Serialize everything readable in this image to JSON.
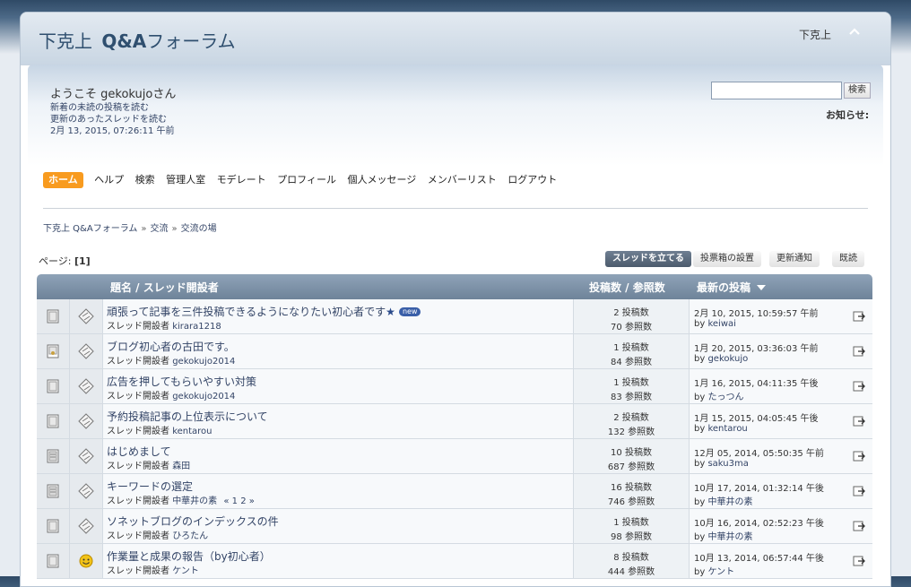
{
  "header": {
    "forum_title_prefix": "下克上",
    "forum_title_bold": "Q&A",
    "forum_title_suffix": "フォーラム",
    "top_right_text": "下克上",
    "upshrink_icon": "chevron-up-icon"
  },
  "user": {
    "welcome": "ようこそ gekokujoさん",
    "link_unread": "新着の未読の投稿を読む",
    "link_replies": "更新のあったスレッドを読む",
    "datetime": "2月 13, 2015, 07:26:11 午前"
  },
  "search": {
    "value": "",
    "button": "検索"
  },
  "news_label": "お知らせ:",
  "menu": {
    "items": [
      "ホーム",
      "ヘルプ",
      "検索",
      "管理人室",
      "モデレート",
      "プロフィール",
      "個人メッセージ",
      "メンバーリスト",
      "ログアウト"
    ],
    "active": "ホーム"
  },
  "breadcrumb": [
    "下克上 Q&Aフォーラム",
    "交流",
    "交流の場"
  ],
  "breadcrumb_sep": "»",
  "pages": {
    "label": "ページ:",
    "current": "[1]"
  },
  "buttons": {
    "new_topic": "スレッドを立てる",
    "new_poll": "投票箱の設置",
    "notify": "更新通知",
    "mark_read": "既読"
  },
  "table": {
    "col_subject": "題名 / スレッド開設者",
    "col_stats": "投稿数 / 参照数",
    "col_last": "最新の投稿",
    "sort_icon": "sort-down-icon",
    "started_by_label": "スレッド開設者",
    "posts_suffix": "投稿数",
    "views_suffix": "参照数",
    "by_label": "by",
    "rows": [
      {
        "title": "頑張って記事を三件投稿できるようになりたい初心者です",
        "title_star": "★",
        "new_badge": "new",
        "starter": "kirara1218",
        "posts": "2",
        "views": "70",
        "last_date": "2月 10, 2015, 10:59:57 午前",
        "last_by": "keiwai",
        "icon": "normal-topic-icon",
        "post_icon": "xx-icon"
      },
      {
        "title": "ブログ初心者の古田です。",
        "title_star": "",
        "new_badge": "",
        "starter": "gekokujo2014",
        "posts": "1",
        "views": "84",
        "last_date": "1月 20, 2015, 03:36:03 午前",
        "last_by": "gekokujo",
        "icon": "my-topic-icon",
        "post_icon": "xx-icon"
      },
      {
        "title": "広告を押してもらいやすい対策",
        "title_star": "",
        "new_badge": "",
        "starter": "gekokujo2014",
        "posts": "1",
        "views": "83",
        "last_date": "1月 16, 2015, 04:11:35 午後",
        "last_by": "たっつん",
        "icon": "normal-topic-icon",
        "post_icon": "xx-icon"
      },
      {
        "title": "予約投稿記事の上位表示について",
        "title_star": "",
        "new_badge": "",
        "starter": "kentarou",
        "posts": "2",
        "views": "132",
        "last_date": "1月 15, 2015, 04:05:45 午後",
        "last_by": "kentarou",
        "icon": "normal-topic-icon",
        "post_icon": "xx-icon"
      },
      {
        "title": "はじめまして",
        "title_star": "",
        "new_badge": "",
        "starter": "森田",
        "posts": "10",
        "views": "687",
        "last_date": "12月 05, 2014, 05:50:35 午前",
        "last_by": "saku3ma",
        "icon": "hot-topic-icon",
        "post_icon": "xx-icon"
      },
      {
        "title": "キーワードの選定",
        "title_star": "",
        "new_badge": "",
        "starter": "中華井の素",
        "pages": "« 1 2 »",
        "posts": "16",
        "views": "746",
        "last_date": "10月 17, 2014, 01:32:14 午後",
        "last_by": "中華井の素",
        "icon": "hot-topic-icon",
        "post_icon": "xx-icon"
      },
      {
        "title": "ソネットブログのインデックスの件",
        "title_star": "",
        "new_badge": "",
        "starter": "ひろたん",
        "posts": "1",
        "views": "98",
        "last_date": "10月 16, 2014, 02:52:23 午後",
        "last_by": "中華井の素",
        "icon": "normal-topic-icon",
        "post_icon": "xx-icon"
      },
      {
        "title": "作業量と成果の報告（by初心者）",
        "title_star": "",
        "new_badge": "",
        "starter": "ケント",
        "posts": "8",
        "views": "444",
        "last_date": "10月 13, 2014, 06:57:44 午後",
        "last_by": "ケント",
        "icon": "normal-topic-icon",
        "post_icon": "smiley-icon"
      }
    ]
  },
  "colors": {
    "accent_orange": "#f89b1f",
    "header_bar": "#7a8ea4",
    "link": "#334466"
  }
}
